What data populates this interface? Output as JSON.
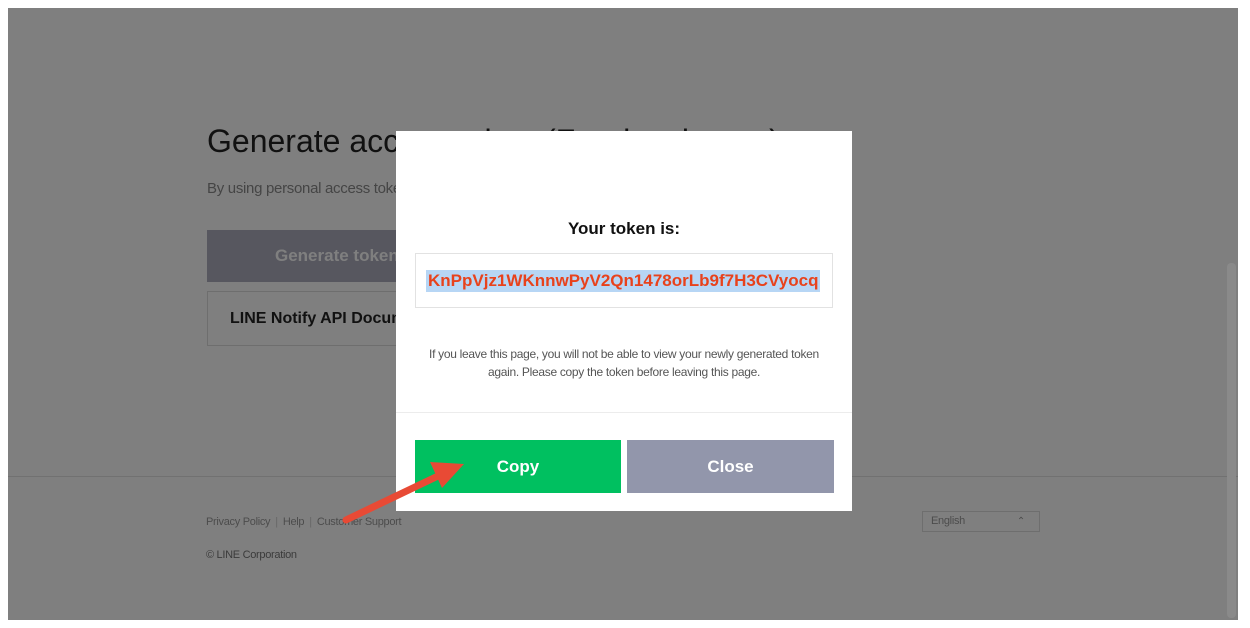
{
  "background_page": {
    "title": "Generate access token (For developers)",
    "description": "By using personal access tokens, you can configure notifications without having to add a web service.",
    "generate_button": "Generate token",
    "docs_button": "LINE Notify API Document",
    "footer": {
      "links": [
        "Privacy Policy",
        "Help",
        "Customer Support"
      ],
      "copyright": "© LINE Corporation",
      "language": "English"
    }
  },
  "modal": {
    "title": "Your token is:",
    "token": "KnPpVjz1WKnnwPyV2Qn1478orLb9f7H3CVyocq",
    "warning": "If you leave this page, you will not be able to view your newly generated token again. Please copy the token before leaving this page.",
    "copy_button": "Copy",
    "close_button": "Close"
  },
  "colors": {
    "copy_button": "#00c060",
    "close_button": "#9296ab",
    "token_text": "#e8421c",
    "token_highlight": "#b7d6f5",
    "annotation_arrow": "#e84a35"
  },
  "icons": {
    "language_chevron": "chevron-up-icon",
    "annotation": "arrow-annotation-icon"
  }
}
